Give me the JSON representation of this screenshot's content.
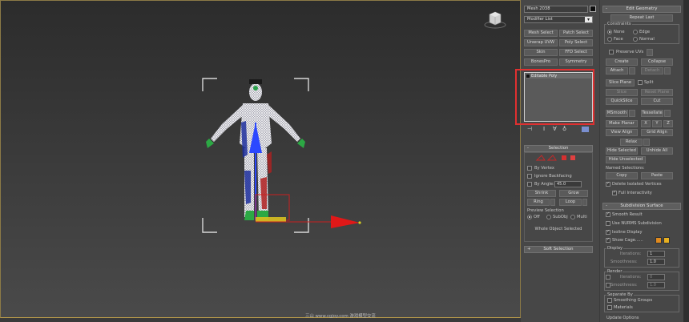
{
  "left": {
    "object_name": "Mesh 2038",
    "modifier_list": "Modifier List",
    "modifier_buttons": [
      "Mesh Select",
      "Patch Select",
      "Unwrap UVW",
      "Poly Select",
      "Skin",
      "FFD Select",
      "BonesPro",
      "Symmetry"
    ],
    "stack_item": "Editable Poly",
    "selection": {
      "title": "Selection",
      "by_vertex": "By Vertex",
      "ignore_backfacing": "Ignore Backfacing",
      "by_angle": "By Angle:",
      "angle_value": "45.0",
      "shrink": "Shrink",
      "grow": "Grow",
      "ring": "Ring",
      "loop": "Loop",
      "preview_title": "Preview Selection",
      "preview_options": [
        "Off",
        "SubObj",
        "Multi"
      ],
      "status": "Whole Object Selected"
    },
    "soft_selection": "Soft Selection"
  },
  "right": {
    "edit_geometry_title": "Edit Geometry",
    "repeat_last": "Repeat Last",
    "constraints_label": "Constraints",
    "constraint_options": [
      "None",
      "Edge",
      "Face",
      "Normal"
    ],
    "preserve_uvs": "Preserve UVs",
    "create": "Create",
    "collapse": "Collapse",
    "attach": "Attach",
    "detach": "Detach",
    "slice_plane": "Slice Plane",
    "split": "Split",
    "slice": "Slice",
    "reset_plane": "Reset Plane",
    "quickslice": "QuickSlice",
    "cut": "Cut",
    "msmooth": "MSmooth",
    "tessellate": "Tessellate",
    "make_planar": "Make Planar",
    "axes": [
      "X",
      "Y",
      "Z"
    ],
    "view_align": "View Align",
    "grid_align": "Grid Align",
    "relax": "Relax",
    "hide_selected": "Hide Selected",
    "unhide_all": "Unhide All",
    "hide_unselected": "Hide Unselected",
    "named_selections": "Named Selections:",
    "copy": "Copy",
    "paste": "Paste",
    "delete_isolated": "Delete Isolated Vertices",
    "full_interactivity": "Full Interactivity",
    "subdivision_title": "Subdivision Surface",
    "smooth_result": "Smooth Result",
    "use_nurms": "Use NURMS Subdivision",
    "isoline_display": "Isoline Display",
    "show_cage": "Show Cage......",
    "display_label": "Display",
    "iterations": "Iterations:",
    "smoothness": "Smoothness:",
    "display_iterations": "1",
    "display_smoothness": "1.0",
    "render_label": "Render",
    "render_iterations": "0",
    "render_smoothness": "1.0",
    "separate_by": "Separate By",
    "smoothing_groups": "Smoothing Groups",
    "materials": "Materials",
    "update_options": "Update Options",
    "colors": {
      "cage_color_1": "#e08a1e",
      "cage_color_2": "#e8b020",
      "red_highlight": "#e03030"
    }
  },
  "watermark": "三山 www.cgjoy.com 游戏模型交流"
}
